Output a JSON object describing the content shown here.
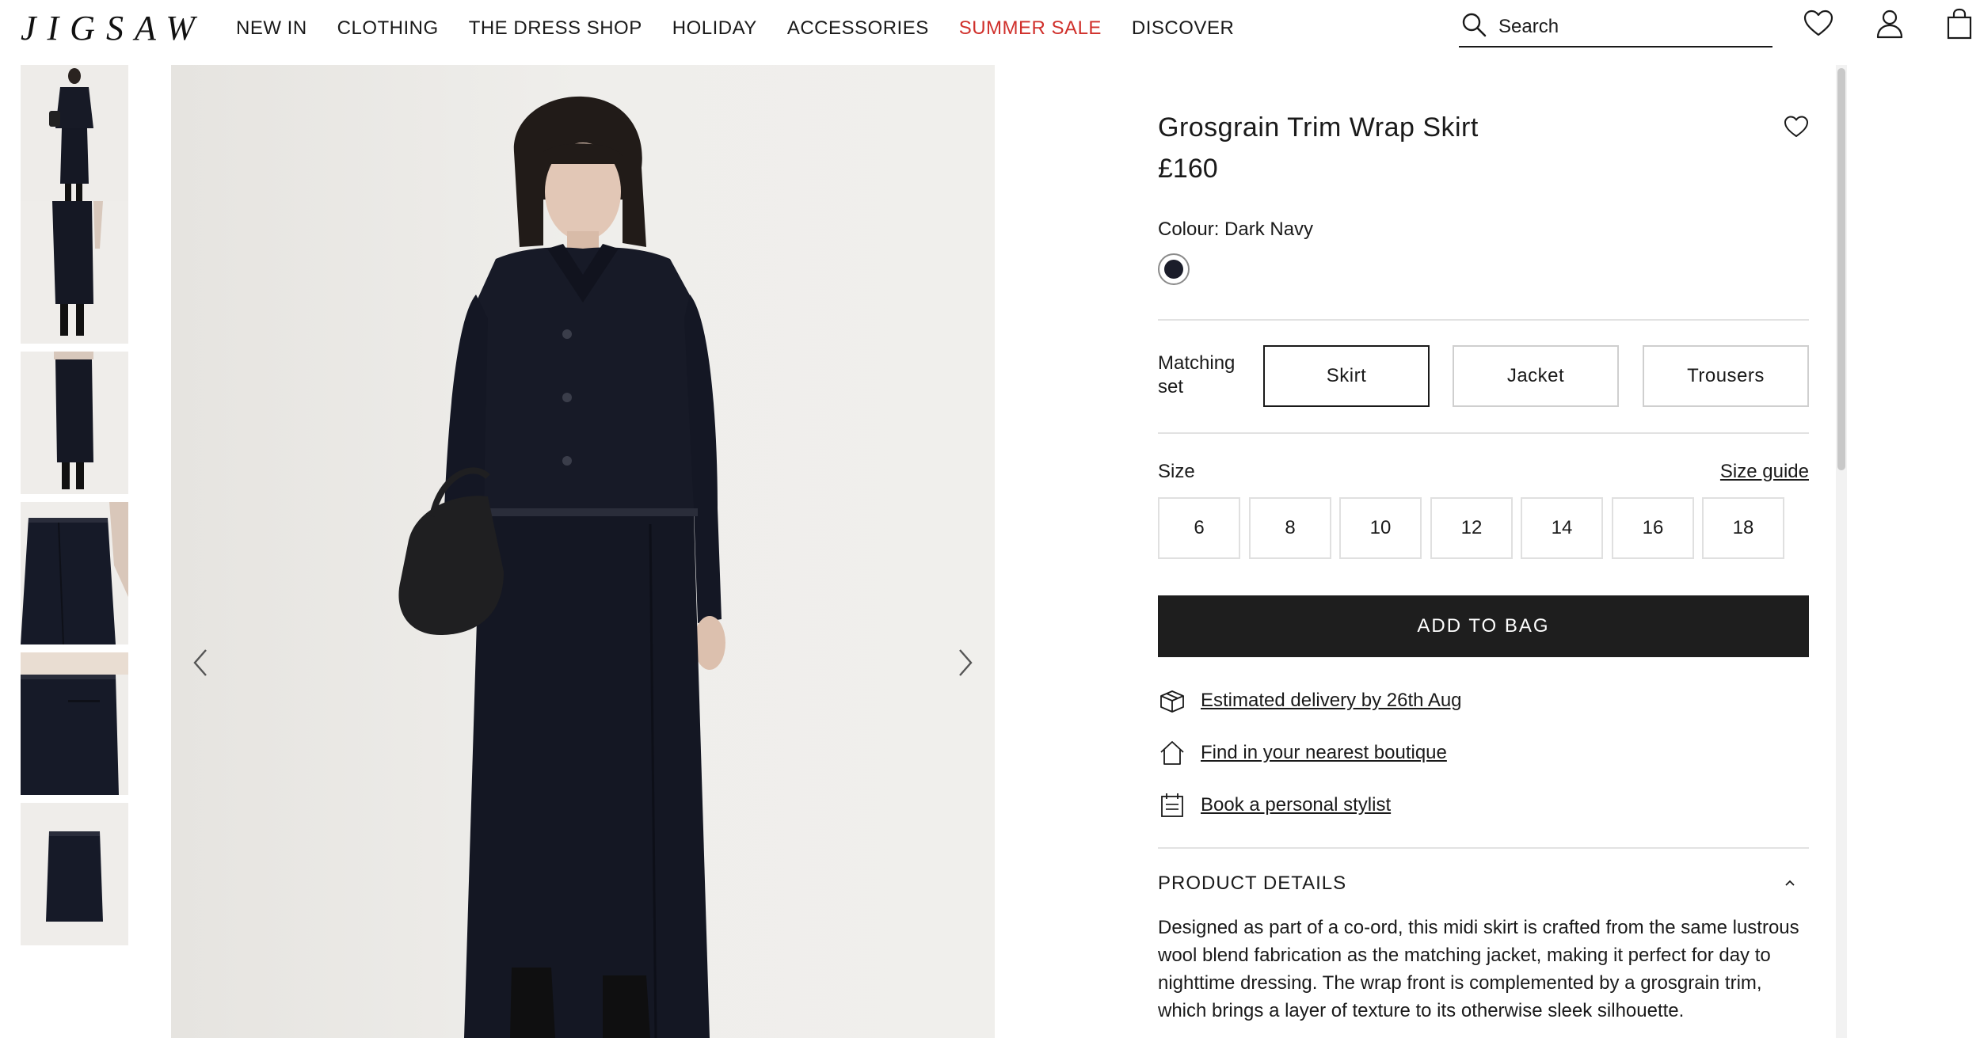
{
  "header": {
    "logo": "JIGSAW",
    "nav": [
      {
        "label": "NEW IN"
      },
      {
        "label": "CLOTHING"
      },
      {
        "label": "THE DRESS SHOP"
      },
      {
        "label": "HOLIDAY"
      },
      {
        "label": "ACCESSORIES"
      },
      {
        "label": "SUMMER SALE",
        "highlight": true
      },
      {
        "label": "DISCOVER"
      }
    ],
    "search_placeholder": "Search",
    "icons": [
      "search-icon",
      "heart-icon",
      "account-icon",
      "bag-icon"
    ]
  },
  "gallery": {
    "thumbnails": [
      "jacket-and-skirt-front",
      "skirt-side",
      "skirt-side-2",
      "skirt-detail",
      "skirt-back-detail",
      "skirt-flat"
    ],
    "active_thumbnail": 0,
    "main_image": "model-wearing-navy-jacket-and-wrap-skirt"
  },
  "product": {
    "title": "Grosgrain Trim Wrap Skirt",
    "price": "£160",
    "colour_label": "Colour: Dark Navy",
    "colour_swatch": "#1b1d2a",
    "matching_label": "Matching set",
    "matching_options": [
      "Skirt",
      "Jacket",
      "Trousers"
    ],
    "matching_selected": "Skirt",
    "size_label": "Size",
    "size_guide": "Size guide",
    "sizes": [
      "6",
      "8",
      "10",
      "12",
      "14",
      "16",
      "18"
    ],
    "add_to_bag": "ADD TO BAG",
    "delivery": "Estimated delivery by 26th Aug",
    "boutique": "Find in your nearest boutique",
    "stylist": "Book a personal stylist",
    "details_heading": "PRODUCT DETAILS",
    "details_text": "Designed as part of a co-ord, this midi skirt is crafted from the same lustrous wool blend fabrication as the matching jacket, making it perfect for day to nighttime dressing. The wrap front is complemented by a grosgrain trim, which brings a layer of texture to its otherwise sleek silhouette."
  },
  "colors": {
    "accent_sale": "#d0302b",
    "button_bg": "#1e1e1e"
  }
}
